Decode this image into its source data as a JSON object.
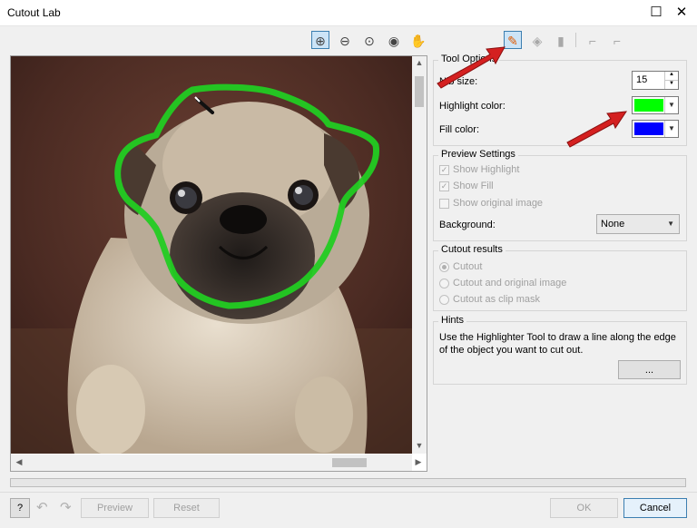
{
  "window": {
    "title": "Cutout Lab",
    "maximize_glyph": "☐",
    "close_glyph": "✕"
  },
  "toolbar": {
    "view_tools": [
      {
        "name": "zoom-in-icon",
        "glyph": "⊕",
        "active": true
      },
      {
        "name": "zoom-out-icon",
        "glyph": "⊖",
        "active": false
      },
      {
        "name": "zoom-fit-icon",
        "glyph": "⊙",
        "active": false
      },
      {
        "name": "zoom-actual-icon",
        "glyph": "◉",
        "active": false
      },
      {
        "name": "pan-hand-icon",
        "glyph": "✋",
        "active": false
      }
    ],
    "edit_tools": [
      {
        "name": "highlighter-icon",
        "glyph": "✎",
        "active": true,
        "disabled": false
      },
      {
        "name": "fill-bucket-icon",
        "glyph": "◈",
        "active": false,
        "disabled": true
      },
      {
        "name": "eraser-icon",
        "glyph": "▮",
        "active": false,
        "disabled": true
      },
      {
        "name": "extract-node-icon",
        "glyph": "⌐",
        "active": false,
        "disabled": true
      },
      {
        "name": "smoothing-node-icon",
        "glyph": "⌐",
        "active": false,
        "disabled": true
      }
    ]
  },
  "tool_options": {
    "title": "Tool Options",
    "nib_size_label": "Nib size:",
    "nib_size_value": "15",
    "highlight_color_label": "Highlight color:",
    "highlight_color": "#00ff00",
    "fill_color_label": "Fill color:",
    "fill_color": "#0000ff"
  },
  "preview_settings": {
    "title": "Preview Settings",
    "show_highlight": "Show Highlight",
    "show_fill": "Show Fill",
    "show_original": "Show original image",
    "background_label": "Background:",
    "background_value": "None"
  },
  "cutout_results": {
    "title": "Cutout results",
    "options": [
      "Cutout",
      "Cutout and original image",
      "Cutout as clip mask"
    ]
  },
  "hints": {
    "title": "Hints",
    "text_line1": "Use the Highlighter Tool to draw a line along the edge",
    "text_line2": "of the object you want to cut out.",
    "more_button": "..."
  },
  "footer": {
    "help_button": "?",
    "undo_glyph": "↶",
    "redo_glyph": "↷",
    "preview_button": "Preview",
    "reset_button": "Reset",
    "ok_button": "OK",
    "cancel_button": "Cancel"
  },
  "colors": {
    "accent": "#3c7fb1",
    "arrow": "#d42020",
    "highlight_stroke": "#22cc22"
  }
}
